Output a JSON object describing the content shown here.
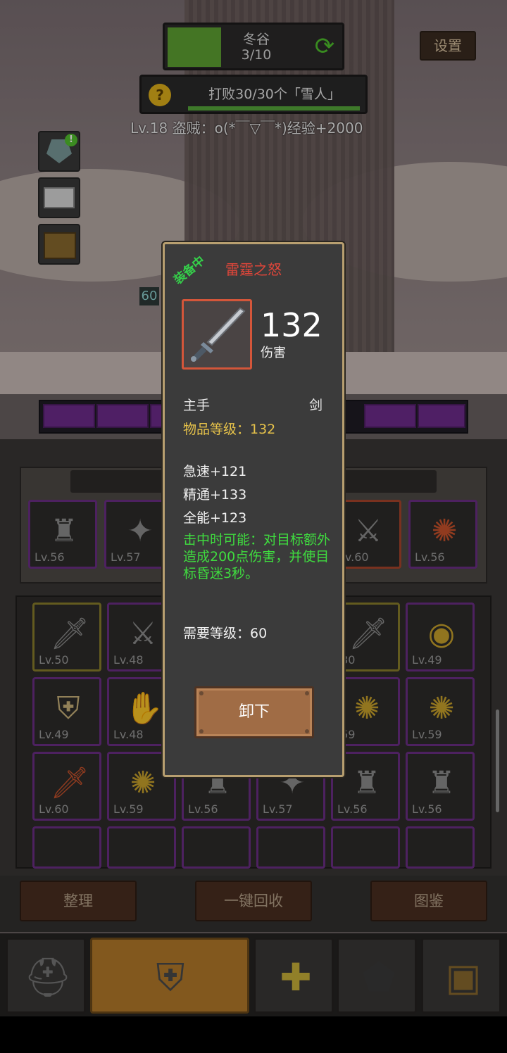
{
  "stage": {
    "name": "冬谷",
    "progress": "3/10",
    "progress_fraction": 0.3
  },
  "settings_label": "设置",
  "quest": {
    "text": "打败30/30个「雪人」",
    "progress_fraction": 1.0
  },
  "log_line": "Lv.18 盗贼：o(*￣▽￣*)经验+2000",
  "level_tag": "60",
  "equipped_slots": [
    {
      "level": "Lv.56",
      "icon": "horned-helm-icon",
      "rarity": "purple"
    },
    {
      "level": "Lv.57",
      "icon": "spiked-shoulder-icon",
      "rarity": "purple"
    },
    {
      "level": "Lv.60",
      "icon": "sword-icon",
      "rarity": "red"
    },
    {
      "level": "Lv.56",
      "icon": "lion-amulet-icon",
      "rarity": "purple"
    }
  ],
  "bag_rows": [
    [
      {
        "level": "Lv.50",
        "icon": "dagger-icon",
        "rarity": "gold"
      },
      {
        "level": "Lv.48",
        "icon": "sword-icon",
        "rarity": "purple"
      },
      {
        "level": ".30",
        "icon": "dagger-icon",
        "rarity": "gold"
      },
      {
        "level": "Lv.49",
        "icon": "ring-icon",
        "rarity": "purple"
      }
    ],
    [
      {
        "level": "Lv.49",
        "icon": "chest-armor-icon",
        "rarity": "purple"
      },
      {
        "level": "Lv.48",
        "icon": "gauntlet-icon",
        "rarity": "purple"
      },
      {
        "level": ".59",
        "icon": "lion-amulet-icon",
        "rarity": "purple"
      },
      {
        "level": "Lv.59",
        "icon": "lion-amulet-icon",
        "rarity": "purple"
      }
    ],
    [
      {
        "level": "Lv.60",
        "icon": "dagger-icon",
        "rarity": "purple"
      },
      {
        "level": "Lv.59",
        "icon": "lion-amulet-icon",
        "rarity": "purple"
      },
      {
        "level": "Lv.56",
        "icon": "horned-helm-icon",
        "rarity": "purple"
      },
      {
        "level": "Lv.57",
        "icon": "spiked-shoulder-icon",
        "rarity": "purple"
      },
      {
        "level": "Lv.56",
        "icon": "horned-helm-icon",
        "rarity": "purple"
      },
      {
        "level": "Lv.56",
        "icon": "horned-helm-icon",
        "rarity": "purple"
      }
    ]
  ],
  "actions": {
    "sort": "整理",
    "recycle": "一键回收",
    "codex": "图鉴"
  },
  "tabs": [
    "helmet-icon",
    "chest-armor-icon",
    "relic-icon",
    "anvil-icon",
    "treasure-chest-icon"
  ],
  "tooltip": {
    "equipped_label": "装备中",
    "name": "雷霆之怒",
    "damage": "132",
    "damage_label": "伤害",
    "slot": "主手",
    "weapon_type": "剑",
    "item_level": "物品等级：132",
    "stats": [
      "急速+121",
      "精通+133",
      "全能+123"
    ],
    "proc": "击中时可能：对目标额外造成200点伤害，并使目标昏迷3秒。",
    "required_level": "需要等级：60",
    "unequip_label": "卸下"
  },
  "colors": {
    "item_name": "#e0463a",
    "item_level": "#e6c24a",
    "proc_text": "#3fdc3f",
    "equipped_label": "#35d04a"
  }
}
